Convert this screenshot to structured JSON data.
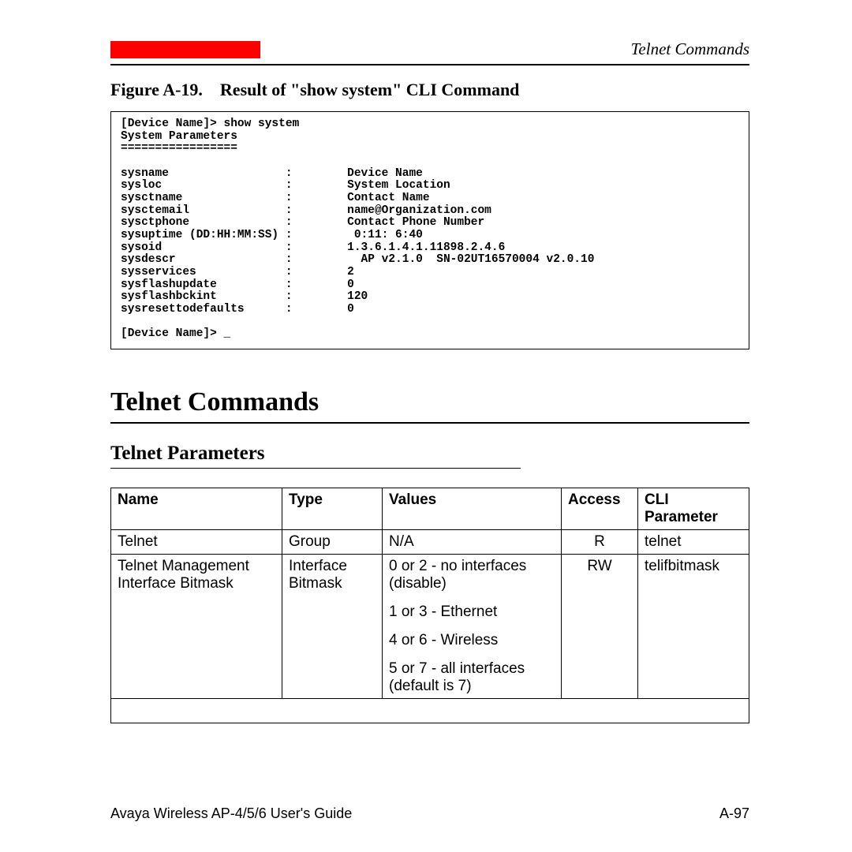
{
  "header": {
    "right": "Telnet Commands"
  },
  "figure": {
    "label": "Figure A-19.",
    "title": "Result of \"show system\" CLI Command"
  },
  "terminal": {
    "prompt1": "[Device Name]> show system",
    "heading": "System Parameters",
    "divider": "=================",
    "rows": [
      {
        "k": "sysname",
        "v": "Device Name"
      },
      {
        "k": "sysloc",
        "v": "System Location"
      },
      {
        "k": "sysctname",
        "v": "Contact Name"
      },
      {
        "k": "sysctemail",
        "v": "name@Organization.com"
      },
      {
        "k": "sysctphone",
        "v": "Contact Phone Number"
      },
      {
        "k": "sysuptime (DD:HH:MM:SS)",
        "v": " 0:11: 6:40"
      },
      {
        "k": "sysoid",
        "v": "1.3.6.1.4.1.11898.2.4.6"
      },
      {
        "k": "sysdescr",
        "v": "  AP v2.1.0  SN-02UT16570004 v2.0.10"
      },
      {
        "k": "sysservices",
        "v": "2"
      },
      {
        "k": "sysflashupdate",
        "v": "0"
      },
      {
        "k": "sysflashbckint",
        "v": "120"
      },
      {
        "k": "sysresettodefaults",
        "v": "0"
      }
    ],
    "prompt2": "[Device Name]> _"
  },
  "section": {
    "title": "Telnet Commands",
    "subtitle": "Telnet Parameters"
  },
  "table": {
    "headers": {
      "name": "Name",
      "type": "Type",
      "values": "Values",
      "access": "Access",
      "cli": "CLI Parameter"
    },
    "rows": [
      {
        "name": "Telnet",
        "type": "Group",
        "values": [
          "N/A"
        ],
        "access": "R",
        "cli": "telnet"
      },
      {
        "name": "Telnet Management Interface Bitmask",
        "type": "Interface Bitmask",
        "values": [
          "0 or 2 - no interfaces (disable)",
          "1 or 3 - Ethernet",
          "4 or 6 - Wireless",
          "5 or 7 - all interfaces (default is 7)"
        ],
        "access": "RW",
        "cli": "telifbitmask"
      }
    ]
  },
  "footer": {
    "left": "Avaya Wireless AP-4/5/6 User's Guide",
    "right": "A-97"
  }
}
